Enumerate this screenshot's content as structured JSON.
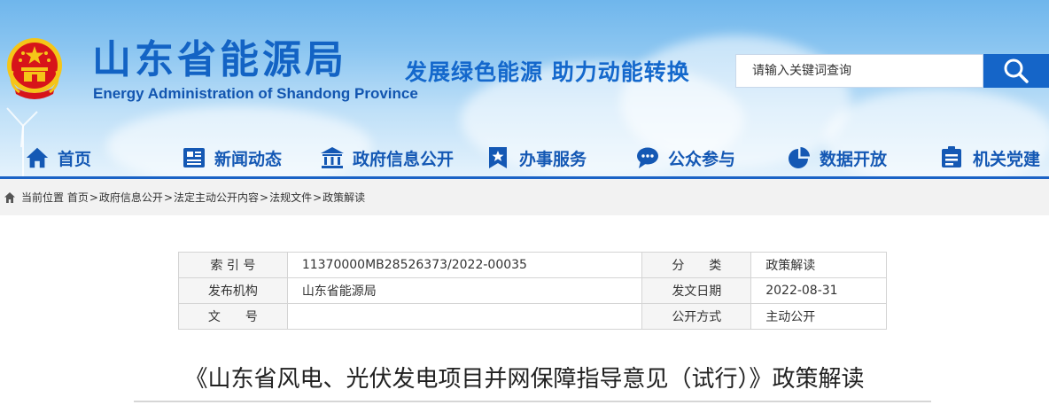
{
  "header": {
    "site_title": "山东省能源局",
    "site_subtitle": "Energy Administration of Shandong Province",
    "slogan": "发展绿色能源  助力动能转换",
    "search": {
      "placeholder": "请输入关键词查询"
    },
    "emblem_icon": "national-emblem-icon",
    "search_icon": "magnifier-icon"
  },
  "nav": {
    "items": [
      {
        "label": "首页",
        "icon": "home-icon"
      },
      {
        "label": "新闻动态",
        "icon": "newspaper-icon"
      },
      {
        "label": "政府信息公开",
        "icon": "government-building-icon"
      },
      {
        "label": "办事服务",
        "icon": "bookmark-star-icon"
      },
      {
        "label": "公众参与",
        "icon": "chat-bubble-icon"
      },
      {
        "label": "数据开放",
        "icon": "pie-chart-icon"
      },
      {
        "label": "机关党建",
        "icon": "party-building-icon"
      }
    ]
  },
  "breadcrumb": {
    "prefix": "当前位置",
    "items": [
      "首页",
      "政府信息公开",
      "法定主动公开内容",
      "法规文件",
      "政策解读"
    ],
    "separator": ">"
  },
  "info_table": {
    "rows": [
      {
        "label1": "索 引 号",
        "value1": "11370000MB28526373/2022-00035",
        "label2": "分　　类",
        "value2": "政策解读"
      },
      {
        "label1": "发布机构",
        "value1": "山东省能源局",
        "label2": "发文日期",
        "value2": "2022-08-31"
      },
      {
        "label1": "文　　号",
        "value1": "",
        "label2": "公开方式",
        "value2": "主动公开"
      }
    ]
  },
  "article": {
    "title": "《山东省风电、光伏发电项目并网保障指导意见（试行）》政策解读"
  },
  "colors": {
    "brand_blue": "#1363c4",
    "nav_blue": "#1458b4",
    "search_button": "#1565c8",
    "emblem_red": "#d7141a",
    "emblem_gold": "#f5c518"
  }
}
